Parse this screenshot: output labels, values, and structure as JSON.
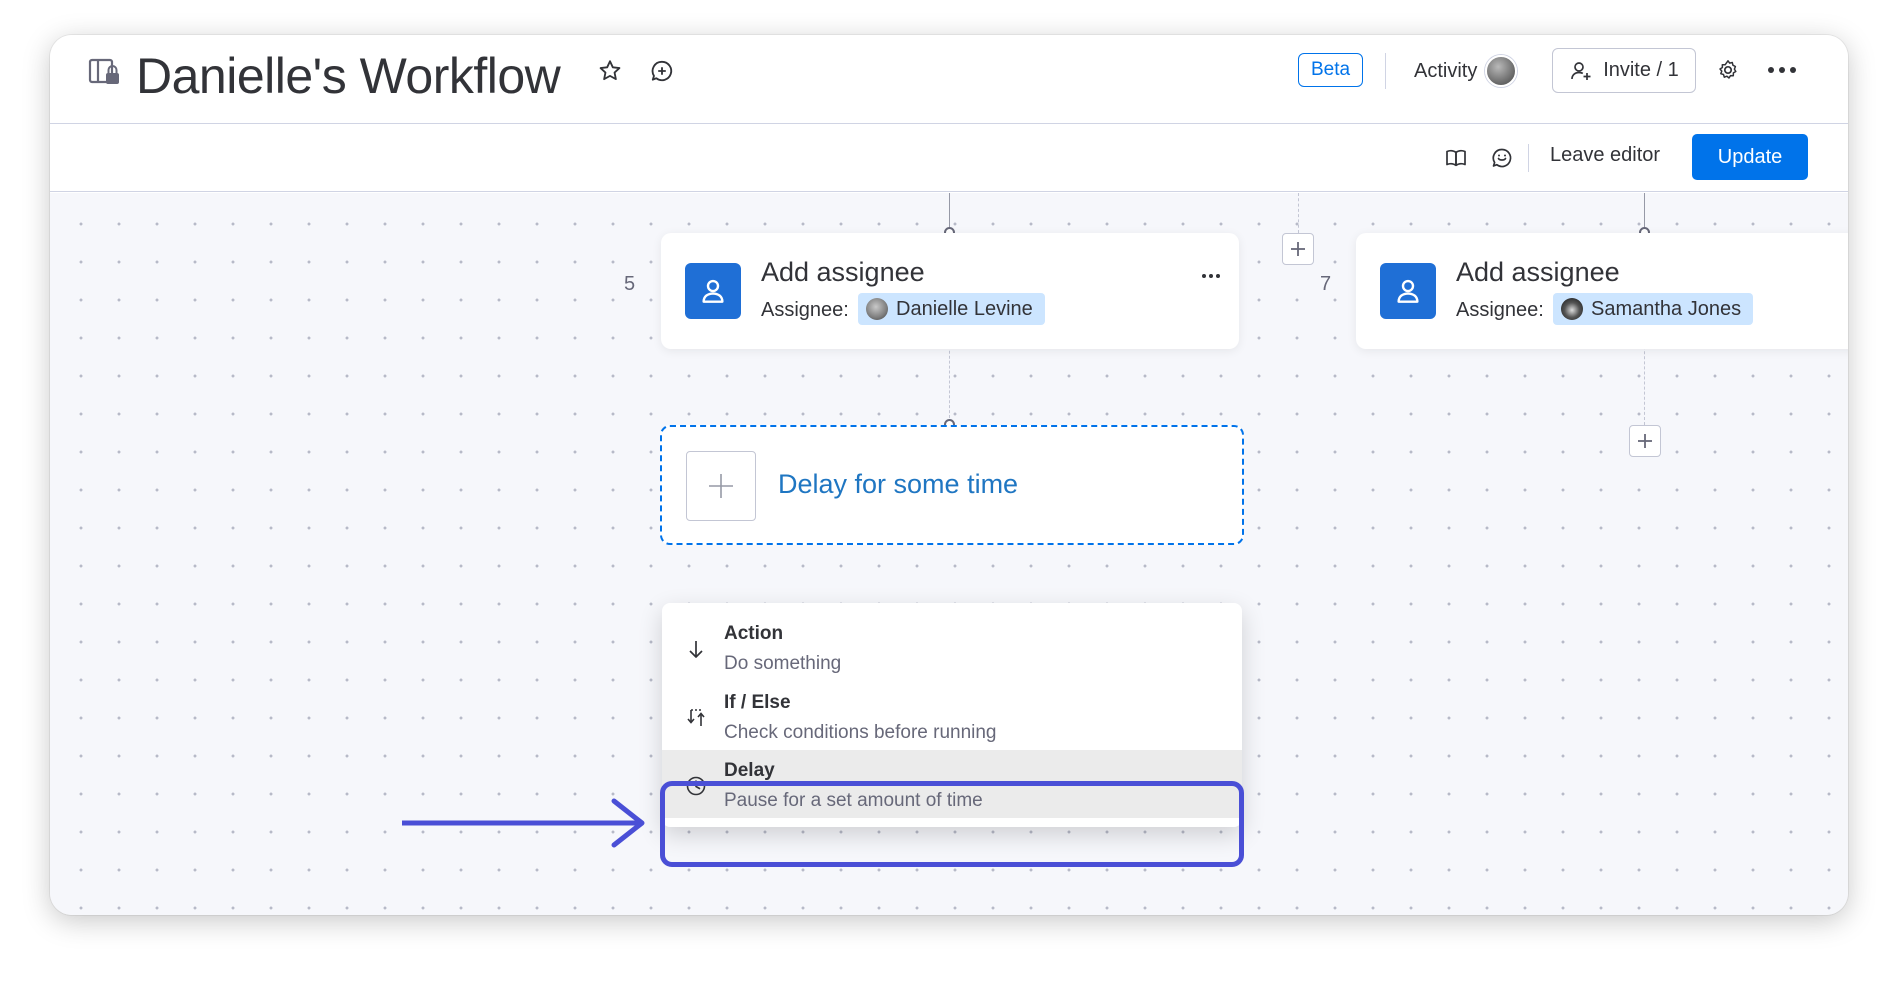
{
  "header": {
    "title": "Danielle's Workflow",
    "beta_label": "Beta",
    "activity_label": "Activity",
    "invite_label": "Invite / 1"
  },
  "toolbar": {
    "leave_editor_label": "Leave editor",
    "update_label": "Update"
  },
  "canvas": {
    "steps": [
      {
        "number": "5",
        "title": "Add assignee",
        "assignee_label": "Assignee:",
        "assignee_name": "Danielle Levine"
      },
      {
        "number": "7",
        "title": "Add assignee",
        "assignee_label": "Assignee:",
        "assignee_name": "Samantha Jones"
      }
    ],
    "pending_step": {
      "label": "Delay for some time"
    },
    "menu": {
      "items": [
        {
          "title": "Action",
          "description": "Do something",
          "icon": "arrow-down-icon"
        },
        {
          "title": "If / Else",
          "description": "Check conditions before running",
          "icon": "branch-icon"
        },
        {
          "title": "Delay",
          "description": "Pause for a set amount of time",
          "icon": "clock-icon",
          "selected": true
        }
      ]
    }
  },
  "colors": {
    "primary": "#0073ea",
    "assignee_icon_bg": "#1f6fd6",
    "chip_bg": "#cce5ff",
    "highlight": "#4a4fd6"
  }
}
